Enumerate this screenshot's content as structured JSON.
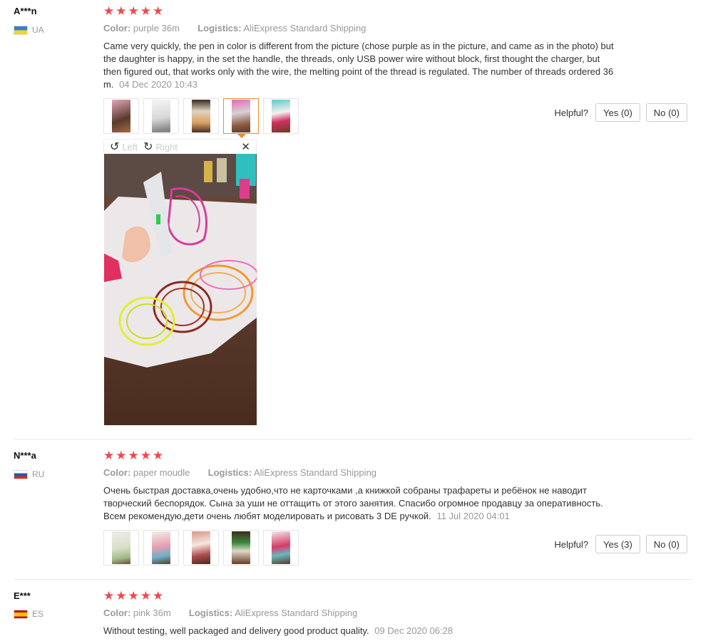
{
  "reviews": [
    {
      "author": "A***n",
      "country": "UA",
      "stars": "★★★★★",
      "color_label": "Color:",
      "color_value": "purple 36m",
      "logistics_label": "Logistics:",
      "logistics_value": "AliExpress Standard Shipping",
      "text": "Came very quickly, the pen in color is different from the picture (chose purple as in the picture, and came as in the photo) but the daughter is happy, in the set the handle, the threads, only USB power wire without block, first thought the charger, but then figured out, that works only with the wire, the melting point of the thread is regulated. The number of threads ordered 36 m.",
      "date": "04 Dec 2020 10:43",
      "helpful_label": "Helpful?",
      "yes_label": "Yes (0)",
      "no_label": "No (0)"
    },
    {
      "author": "N***a",
      "country": "RU",
      "stars": "★★★★★",
      "color_label": "Color:",
      "color_value": "paper moudle",
      "logistics_label": "Logistics:",
      "logistics_value": "AliExpress Standard Shipping",
      "text": "Очень быстрая доставка,очень удобно,что не карточками ,а книжкой собраны трафареты и ребёнок не наводит творческий беспорядок. Сына за уши не оттащить от этого занятия. Спасибо огромное продавцу за оперативность. Всем рекомендую,дети очень любят моделировать и рисовать 3 DE ручкой.",
      "date": "11 Jul 2020 04:01",
      "helpful_label": "Helpful?",
      "yes_label": "Yes (3)",
      "no_label": "No (0)"
    },
    {
      "author": "E***",
      "country": "ES",
      "stars": "★★★★★",
      "color_label": "Color:",
      "color_value": "pink 36m",
      "logistics_label": "Logistics:",
      "logistics_value": "AliExpress Standard Shipping",
      "text": "Without testing, well packaged and delivery good product quality.",
      "date": "09 Dec 2020 06:28"
    }
  ],
  "viewer": {
    "left_label": "Left",
    "right_label": "Right",
    "close_icon": "close-icon"
  },
  "colors": {
    "star": "#f0484f",
    "active_thumb": "#f08a2c",
    "muted": "#999999"
  }
}
